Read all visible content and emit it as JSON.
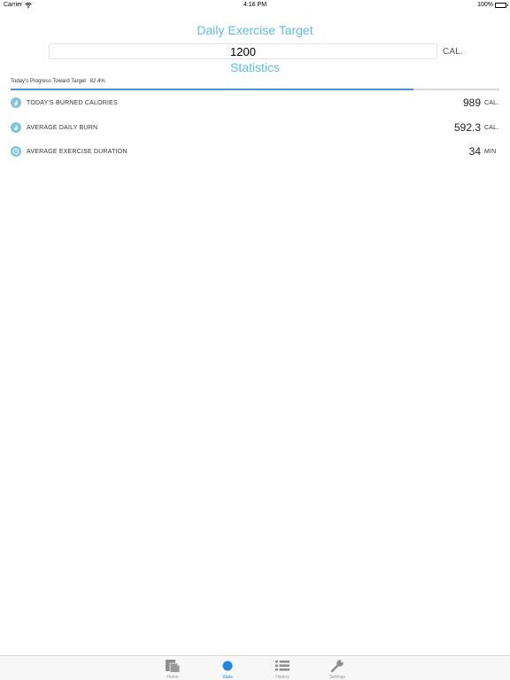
{
  "status_bar": {
    "carrier": "Carrier",
    "time": "4:16 PM",
    "battery": "100%"
  },
  "target": {
    "title": "Daily Exercise Target",
    "value": "1200",
    "unit": "CAL."
  },
  "statistics": {
    "title": "Statistics",
    "progress": {
      "label": "Today's Progress Toward Target",
      "percent_text": "82.4%",
      "fraction": 0.824
    },
    "rows": [
      {
        "label": "TODAY'S BURNED CALORIES",
        "value": "989",
        "unit": "CAL.",
        "icon": "flame-icon"
      },
      {
        "label": "AVERAGE DAILY BURN",
        "value": "592.3",
        "unit": "CAL.",
        "icon": "flame-icon"
      },
      {
        "label": "AVERAGE EXERCISE DURATION",
        "value": "34",
        "unit": "MIN",
        "icon": "clock-icon"
      }
    ]
  },
  "tabs": [
    {
      "label": "Home",
      "icon": "document-icon",
      "active": false
    },
    {
      "label": "Stats",
      "icon": "circle-icon",
      "active": true
    },
    {
      "label": "History",
      "icon": "list-icon",
      "active": false
    },
    {
      "label": "Settings",
      "icon": "wrench-icon",
      "active": false
    }
  ],
  "colors": {
    "accent": "#5bc0de",
    "progress": "#4a90e2",
    "active_tab": "#1e88e5"
  }
}
